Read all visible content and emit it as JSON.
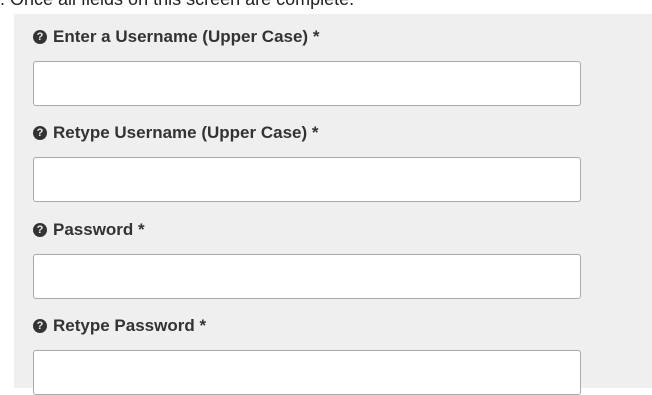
{
  "intro": {
    "text": ". Once all fields on this screen are complete."
  },
  "form": {
    "help_icon_glyph": "?",
    "fields": [
      {
        "label": "Enter a Username (Upper Case) *",
        "value": "",
        "placeholder": ""
      },
      {
        "label": "Retype Username (Upper Case) *",
        "value": "",
        "placeholder": ""
      },
      {
        "label": "Password *",
        "value": "",
        "placeholder": ""
      },
      {
        "label": "Retype Password *",
        "value": "",
        "placeholder": ""
      }
    ]
  },
  "colors": {
    "panel_background": "#efefef",
    "input_border": "#a9a9a9",
    "label_text": "#333333"
  }
}
